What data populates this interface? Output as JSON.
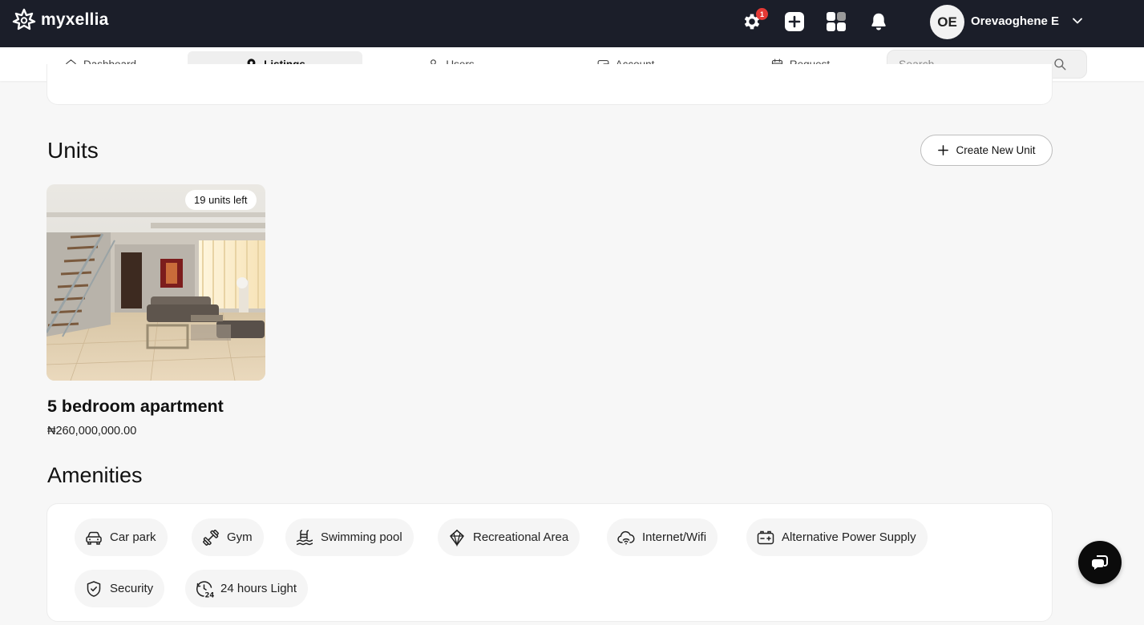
{
  "brand": {
    "name": "myxellia"
  },
  "header": {
    "settings_badge": "1",
    "user_initials": "OE",
    "user_name": "Orevaoghene E"
  },
  "nav": {
    "items": [
      {
        "label": "Dashboard",
        "icon": "home-icon"
      },
      {
        "label": "Listings",
        "icon": "map-pin-icon"
      },
      {
        "label": "Users",
        "icon": "user-icon"
      },
      {
        "label": "Account",
        "icon": "wallet-icon"
      },
      {
        "label": "Request",
        "icon": "calendar-icon"
      }
    ],
    "active": "Listings",
    "search_placeholder": "Search..."
  },
  "units": {
    "title": "Units",
    "create_label": "Create New Unit",
    "items": [
      {
        "units_left": "19 units left",
        "name": "5 bedroom apartment",
        "price": "₦260,000,000.00"
      }
    ]
  },
  "amenities": {
    "title": "Amenities",
    "items": [
      {
        "label": "Car park",
        "icon": "car-icon"
      },
      {
        "label": "Gym",
        "icon": "dumbbell-icon"
      },
      {
        "label": "Swimming pool",
        "icon": "pool-icon"
      },
      {
        "label": "Recreational Area",
        "icon": "recreation-icon"
      },
      {
        "label": "Internet/Wifi",
        "icon": "wifi-cloud-icon"
      },
      {
        "label": "Alternative Power Supply",
        "icon": "battery-icon"
      },
      {
        "label": "Security",
        "icon": "shield-icon"
      },
      {
        "label": "24 hours Light",
        "icon": "clock-24-icon"
      }
    ]
  },
  "colors": {
    "topbar": "#1b1e29",
    "badge": "#e53935",
    "page_bg": "#f7f7f7"
  }
}
